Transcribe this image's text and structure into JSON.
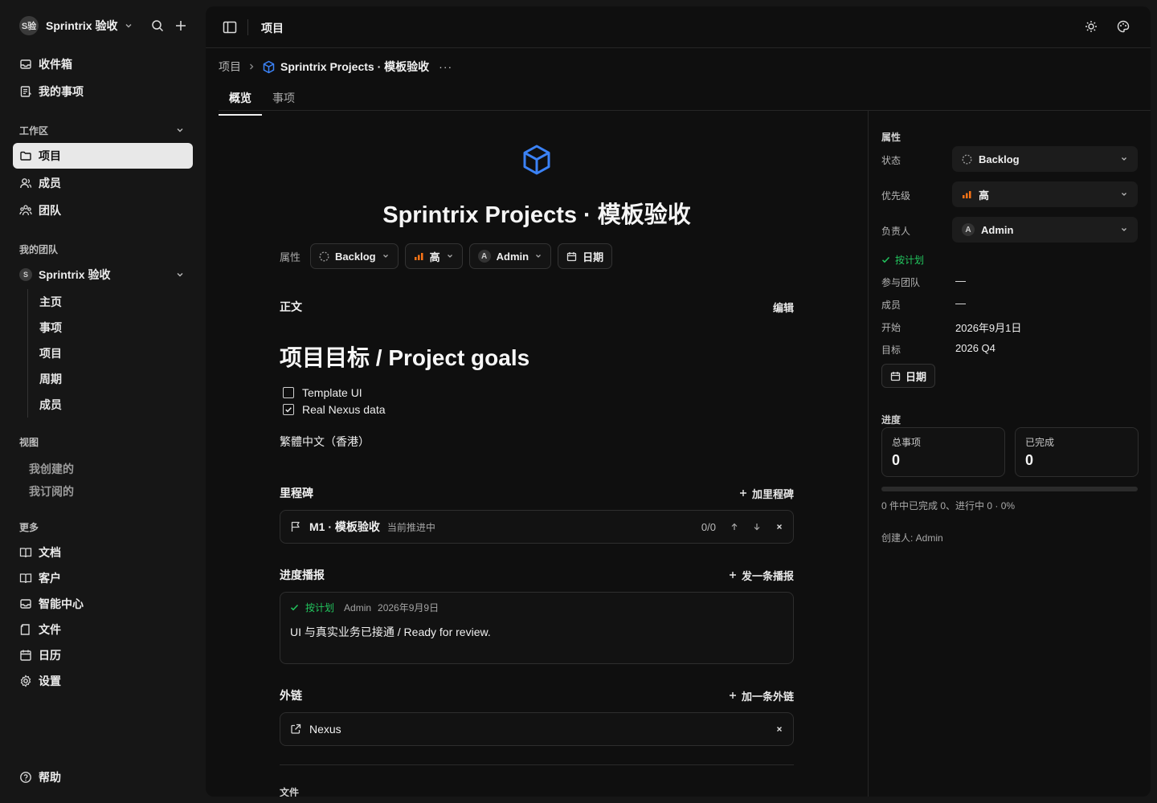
{
  "sidebar": {
    "workspace": {
      "avatar": "S验",
      "name": "Sprintrix 验收"
    },
    "top_items": [
      {
        "label": "收件箱",
        "icon": "inbox-icon"
      },
      {
        "label": "我的事项",
        "icon": "my-issues-icon"
      }
    ],
    "workspace_section": {
      "label": "工作区",
      "items": [
        {
          "label": "项目",
          "icon": "folder-icon",
          "active": true
        },
        {
          "label": "成员",
          "icon": "members-icon"
        },
        {
          "label": "团队",
          "icon": "teams-icon"
        }
      ]
    },
    "my_teams": {
      "label": "我的团队",
      "team": {
        "badge": "S",
        "name": "Sprintrix 验收"
      },
      "sub_items": [
        "主页",
        "事项",
        "项目",
        "周期",
        "成员"
      ]
    },
    "views": {
      "label": "视图",
      "items": [
        "我创建的",
        "我订阅的"
      ]
    },
    "more": {
      "label": "更多",
      "items": [
        {
          "label": "文档",
          "icon": "docs-icon"
        },
        {
          "label": "客户",
          "icon": "customers-icon"
        },
        {
          "label": "智能中心",
          "icon": "ai-center-icon"
        },
        {
          "label": "文件",
          "icon": "files-icon"
        },
        {
          "label": "日历",
          "icon": "calendar-icon"
        },
        {
          "label": "设置",
          "icon": "settings-icon"
        }
      ]
    },
    "help": "帮助"
  },
  "topbar": {
    "title": "项目"
  },
  "breadcrumb": {
    "root": "项目",
    "current": "Sprintrix Projects · 模板验收",
    "more": "···"
  },
  "tabs": [
    {
      "label": "概览",
      "active": true
    },
    {
      "label": "事项",
      "active": false
    }
  ],
  "project": {
    "title": "Sprintrix Projects · 模板验收",
    "props_label": "属性",
    "status": "Backlog",
    "priority": "高",
    "assignee": "Admin",
    "assignee_initial": "A",
    "date_button": "日期"
  },
  "body_section": {
    "label": "正文",
    "edit": "编辑",
    "heading": "项目目标 / Project goals",
    "checklist": [
      {
        "label": "Template UI",
        "checked": false
      },
      {
        "label": "Real Nexus data",
        "checked": true
      }
    ],
    "paragraph": "繁體中文（香港）"
  },
  "milestones": {
    "label": "里程碑",
    "add": "加里程碑",
    "items": [
      {
        "name": "M1 · 模板验收",
        "status": "当前推进中",
        "count": "0/0"
      }
    ]
  },
  "updates": {
    "label": "进度播报",
    "add": "发一条播报",
    "items": [
      {
        "health": "按计划",
        "author": "Admin",
        "date": "2026年9月9日",
        "body": "UI 与真实业务已接通 / Ready for review."
      }
    ]
  },
  "links": {
    "label": "外链",
    "add": "加一条外链",
    "items": [
      {
        "name": "Nexus"
      }
    ]
  },
  "files": {
    "label": "文件"
  },
  "properties": {
    "title": "属性",
    "status_label": "状态",
    "status_value": "Backlog",
    "priority_label": "优先级",
    "priority_value": "高",
    "assignee_label": "负责人",
    "assignee_initial": "A",
    "assignee_value": "Admin",
    "health": "按计划",
    "teams_label": "参与团队",
    "teams_value": "—",
    "members_label": "成员",
    "members_value": "—",
    "start_label": "开始",
    "start_value": "2026年9月1日",
    "target_label": "目标",
    "target_value": "2026 Q4",
    "date_button": "日期"
  },
  "progress": {
    "title": "进度",
    "total_label": "总事项",
    "total_value": "0",
    "done_label": "已完成",
    "done_value": "0",
    "fraction": 0,
    "summary": "0 件中已完成 0、进行中 0 · 0%",
    "creator": "创建人: Admin"
  },
  "colors": {
    "accent_blue": "#3b82f6",
    "healthy_green": "#22c55e",
    "priority_orange": "#f97316"
  }
}
